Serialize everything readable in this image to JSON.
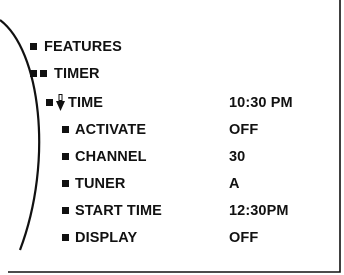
{
  "menu": {
    "features": "FEATURES",
    "timer": "TIMER",
    "items": [
      {
        "label": "TIME",
        "value": "10:30 PM",
        "selected": true
      },
      {
        "label": "ACTIVATE",
        "value": "OFF"
      },
      {
        "label": "CHANNEL",
        "value": "30"
      },
      {
        "label": "TUNER",
        "value": "A"
      },
      {
        "label": "START TIME",
        "value": "12:30PM"
      },
      {
        "label": "DISPLAY",
        "value": "OFF"
      }
    ]
  },
  "icons": {
    "bullet": "square-bullet-icon",
    "cursor": "up-down-cursor-icon"
  }
}
